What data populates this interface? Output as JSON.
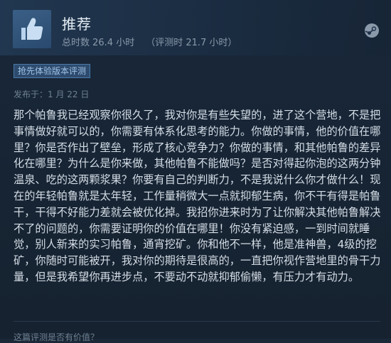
{
  "review": {
    "verdict": "推荐",
    "hours_total": "总时数 26.4 小时",
    "hours_at_review": "（评测时 21.7 小时）",
    "badge": "抢先体验版本评测",
    "posted": "发布于：1 月 22 日",
    "body": "那个帕鲁我已经观察你很久了，我对你是有些失望的，进了这个营地，不是把事情做好就可以的，你需要有体系化思考的能力。你做的事情，他的价值在哪里？你是否作出了壁垒，形成了核心竞争力？你做的事情，和其他帕鲁的差异化在哪里？为什么是你来做，其他帕鲁不能做吗？是否对得起你泡的这两分钟温泉、吃的这两颗浆果？你要有自己的判断力，不是我说什么你才做什么！现在的年轻帕鲁就是太年轻，工作量稍微大一点就抑郁生病，你不干有得是帕鲁干，干得不好能力差就会被优化掉。我招你进来时为了让你解决其他帕鲁解决不了的问题的，你需要证明你的价值在哪里！你没有紧迫感，一到时间就睡觉，别人新来的实习帕鲁，通宵挖矿。你和他不一样，他是准神兽，4级的挖矿，你随时可能被开，我对你的期待是很高的，一直把你视作营地里的骨干力量，但是我希望你再进步点，不要动不动就抑郁偷懒，有压力才有动力。",
    "helpful_prompt": "这篇评测是否有价值？"
  },
  "icons": {
    "verdict_icon": "thumbs-up-icon",
    "platform_icon": "steam-logo-icon"
  },
  "colors": {
    "background": "#1b2838",
    "badge_border": "#4a7aa8",
    "badge_text": "#9fc4e8"
  }
}
